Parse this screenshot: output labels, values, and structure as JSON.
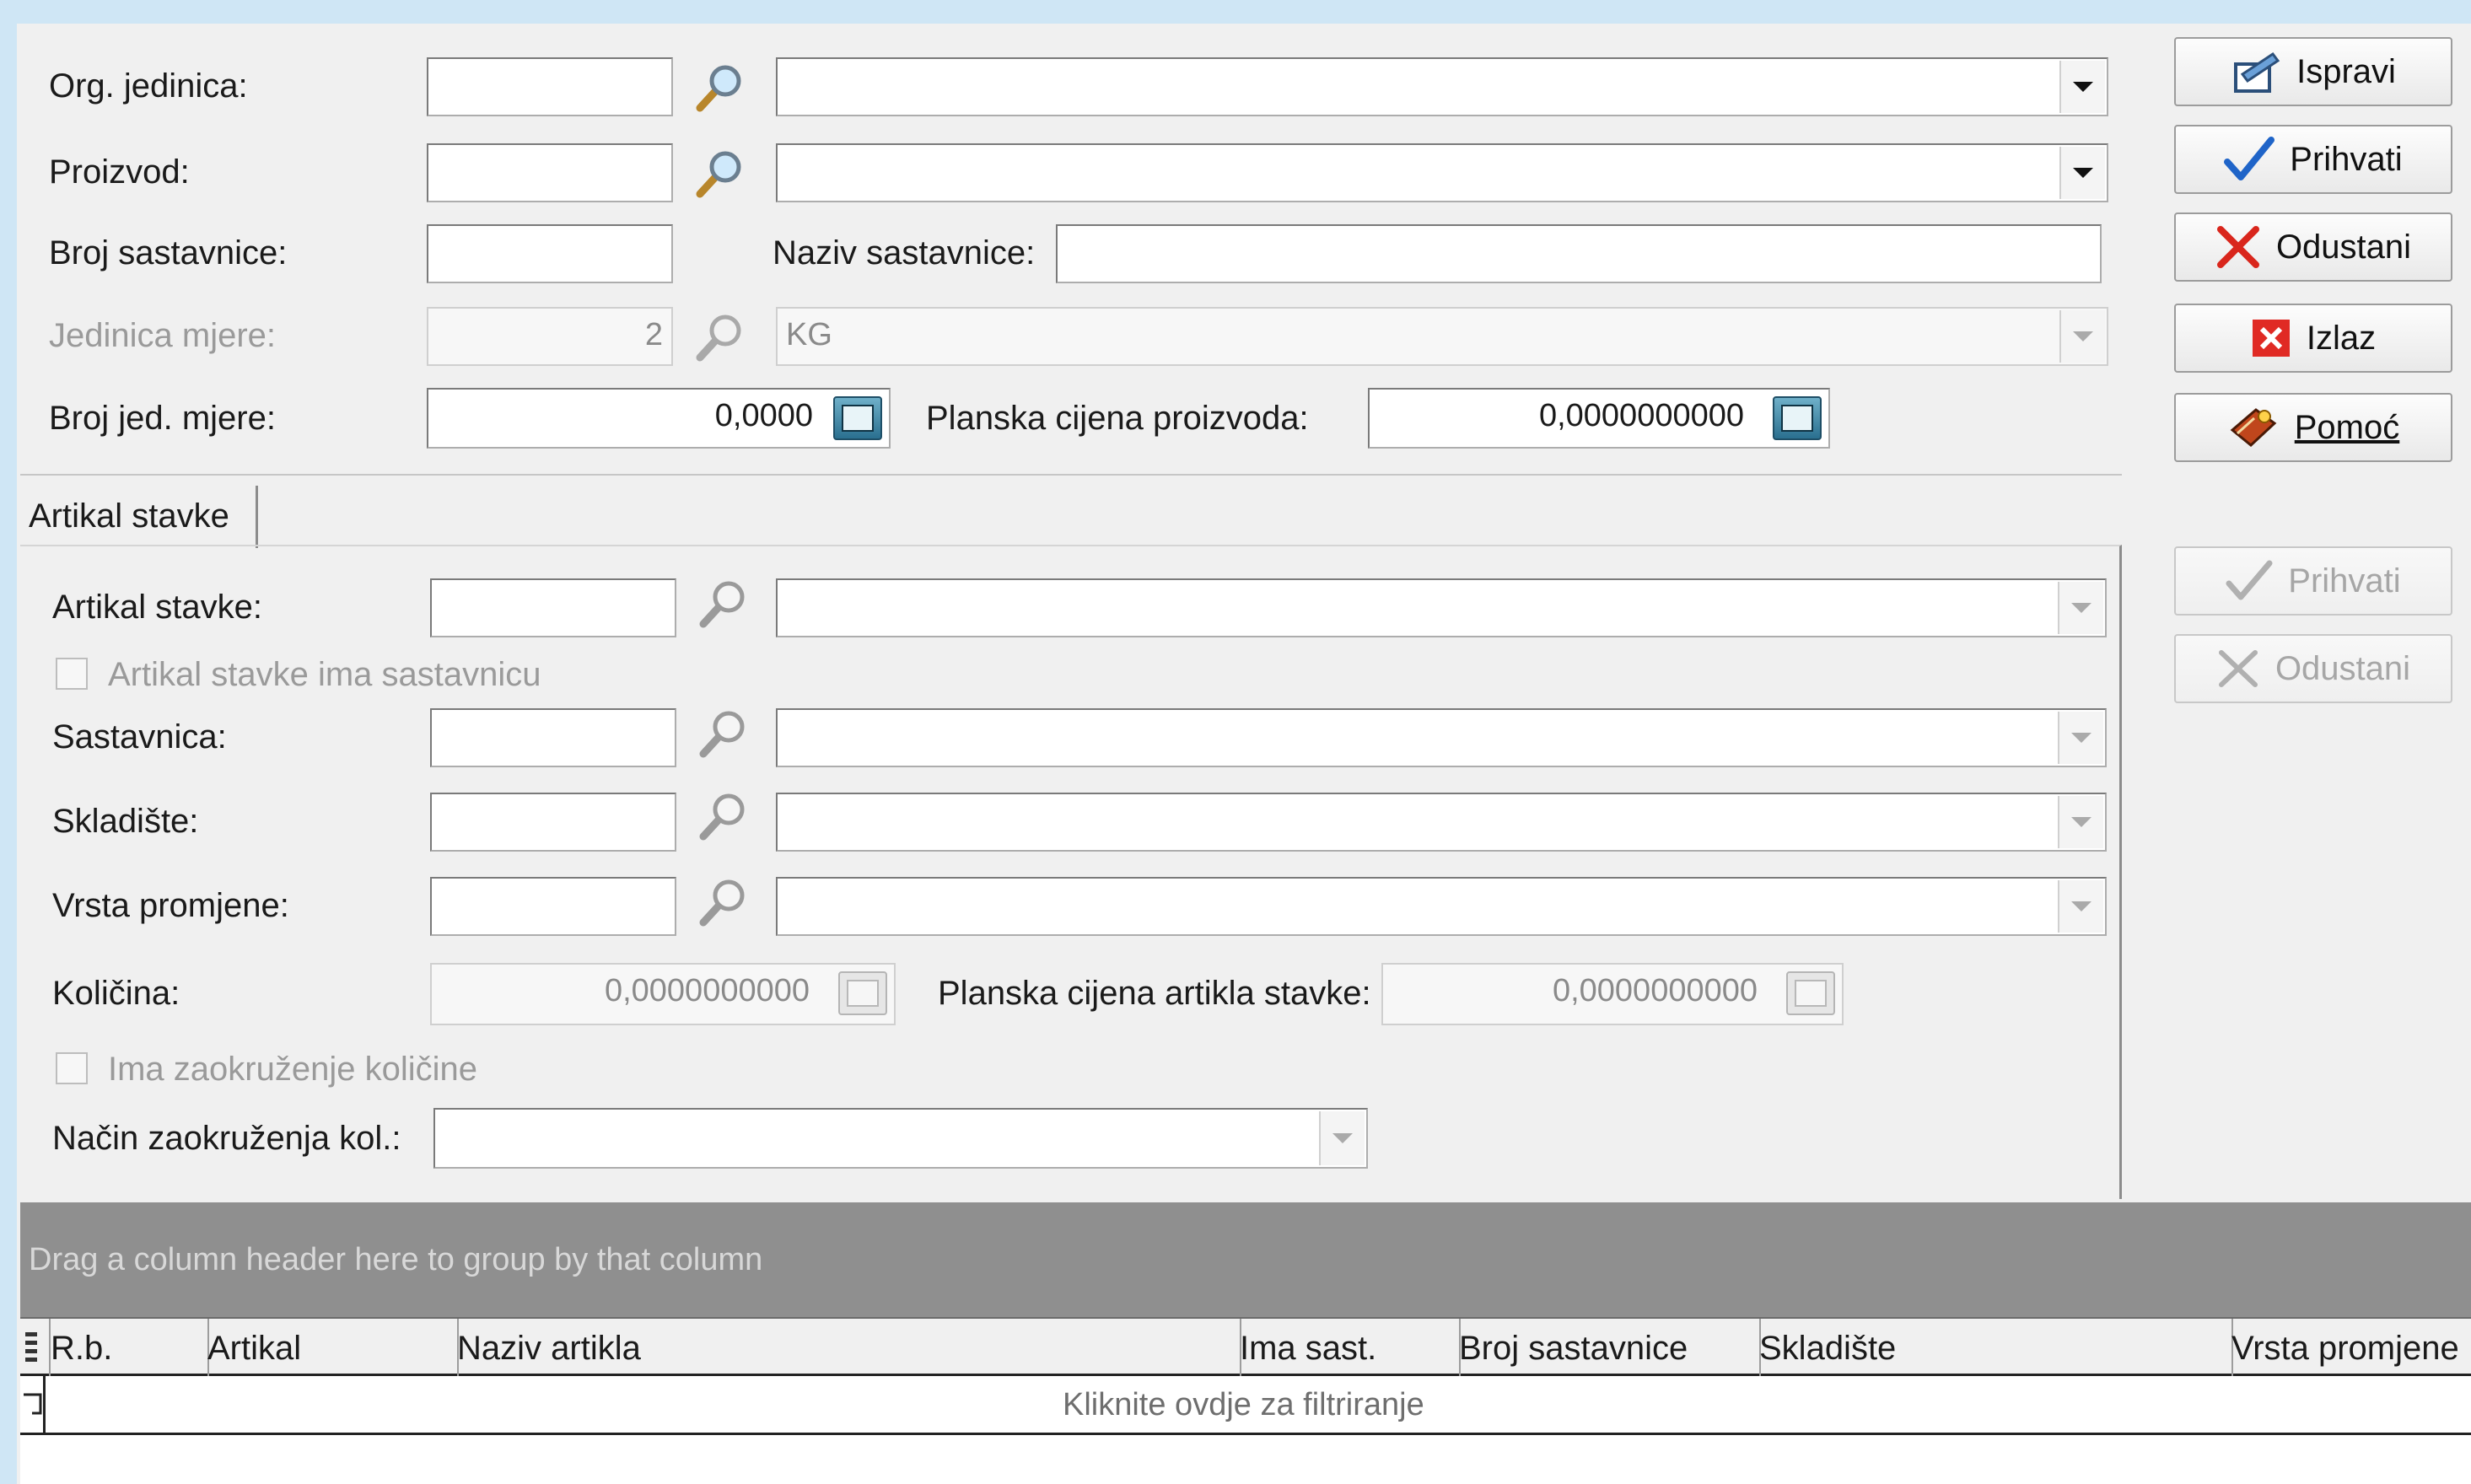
{
  "form": {
    "org_label": "Org. jedinica:",
    "proizvod_label": "Proizvod:",
    "broj_sast_label": "Broj sastavnice:",
    "naziv_sast_label": "Naziv sastavnice:",
    "jed_mjere_label": "Jedinica mjere:",
    "jed_mjere_code": "2",
    "jed_mjere_value": "KG",
    "broj_jed_label": "Broj jed. mjere:",
    "broj_jed_value": "0,0000",
    "planska_label": "Planska cijena proizvoda:",
    "planska_value": "0,0000000000"
  },
  "actions": {
    "ispravi": "Ispravi",
    "prihvati": "Prihvati",
    "odustani": "Odustani",
    "izlaz": "Izlaz",
    "pomoc": "Pomoć"
  },
  "tab": {
    "label": "Artikal stavke"
  },
  "item": {
    "artikal_label": "Artikal stavke:",
    "ima_sast_label": "Artikal stavke ima sastavnicu",
    "sastavnica_label": "Sastavnica:",
    "skladiste_label": "Skladište:",
    "vrsta_label": "Vrsta promjene:",
    "kolicina_label": "Količina:",
    "kolicina_value": "0,0000000000",
    "planska_art_label": "Planska cijena artikla stavke:",
    "planska_art_value": "0,0000000000",
    "zaokr_label": "Ima zaokruženje količine",
    "nacin_label": "Način zaokruženja kol.:"
  },
  "item_actions": {
    "prihvati": "Prihvati",
    "odustani": "Odustani"
  },
  "grid": {
    "group_hint": "Drag a column header here to group by that column",
    "columns": [
      "R.b.",
      "Artikal",
      "Naziv artikla",
      "Ima sast.",
      "Broj sastavnice",
      "Skladište",
      "Vrsta promjene"
    ],
    "filter_hint": "Kliknite ovdje za filtriranje"
  },
  "colors": {
    "background": "#cfe6f5",
    "window": "#f0f0f0",
    "group_panel": "#8f8f8f"
  }
}
